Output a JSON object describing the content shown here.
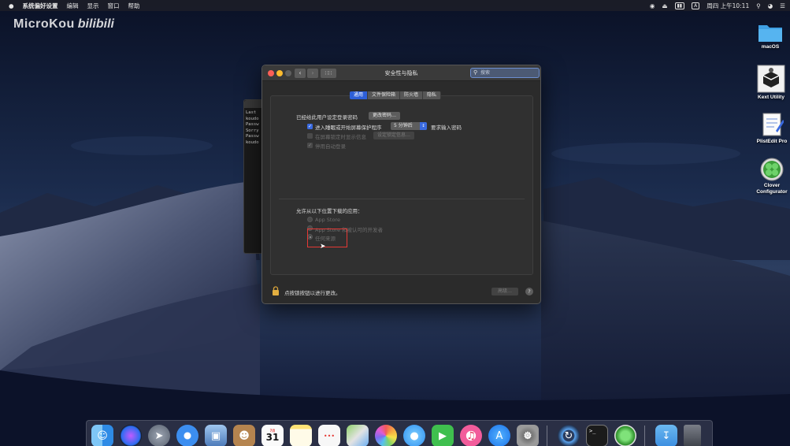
{
  "colors": {
    "accent": "#2d5fd8",
    "highlight_box": "#e53935",
    "close": "#fc5f57",
    "minimize": "#fdbc2e"
  },
  "menubar": {
    "apple_icon": "apple-icon",
    "app_name": "系统偏好设置",
    "menus": [
      "编辑",
      "显示",
      "窗口",
      "帮助"
    ],
    "status_icons": [
      "airdrop-icon",
      "eject-icon",
      "battery-icon",
      "input-method-icon"
    ],
    "input_method": "A",
    "clock": "周四 上午10:11",
    "right_icons": [
      "search-icon",
      "siri-icon",
      "control-icon"
    ]
  },
  "watermark": {
    "brand": "MicroKou",
    "site": "bilibili"
  },
  "desktop_icons": [
    {
      "label": "macOS",
      "icon": "folder-icon"
    },
    {
      "label": "Kext Utility",
      "icon": "kext-utility-icon"
    },
    {
      "label": "PlistEdit Pro",
      "icon": "plistedit-icon"
    },
    {
      "label": "Clover Configurator",
      "icon": "clover-icon"
    }
  ],
  "terminal": {
    "lines": [
      "Last",
      "koudo",
      "Passw",
      "Sorry",
      "Passw",
      "koudo"
    ]
  },
  "window": {
    "title": "安全性与隐私",
    "search_placeholder": "搜索",
    "tabs": [
      "通用",
      "文件保险箱",
      "防火墙",
      "隐私"
    ],
    "active_tab": "通用",
    "password_set_text": "已经给此用户设定登录密码",
    "change_password_button": "更改密码…",
    "require_password": {
      "checked": true,
      "label": "进入睡眠或开始屏幕保护程序",
      "delay_value": "5 分钟后",
      "suffix": "要求输入密码"
    },
    "show_message": {
      "checked": false,
      "label": "在屏幕锁定时显示信息",
      "button": "设定锁定信息…"
    },
    "disable_autologin": {
      "checked": true,
      "label": "停用自动登录"
    },
    "allow_apps": {
      "title": "允许从以下位置下载的应用：",
      "options": [
        "App Store",
        "App Store 和被认可的开发者",
        "任何来源"
      ],
      "selected": "任何来源"
    },
    "footer": {
      "lock_text": "点按锁按钮以进行更改。",
      "advanced_button": "高级…",
      "help": "?"
    }
  },
  "dock": {
    "items": [
      "finder-icon",
      "siri-icon",
      "launchpad-icon",
      "safari-icon",
      "preview-icon",
      "contacts-icon",
      "calendar-icon",
      "notes-icon",
      "reminders-icon",
      "maps-icon",
      "photos-icon",
      "messages-icon",
      "facetime-icon",
      "itunes-icon",
      "app-store-icon",
      "system-preferences-icon",
      "sync-icon",
      "terminal-icon",
      "clover-icon",
      "downloads-folder-icon",
      "trash-icon"
    ],
    "calendar_day": "31",
    "calendar_month": "7月",
    "terminal_prompt": ">_"
  }
}
